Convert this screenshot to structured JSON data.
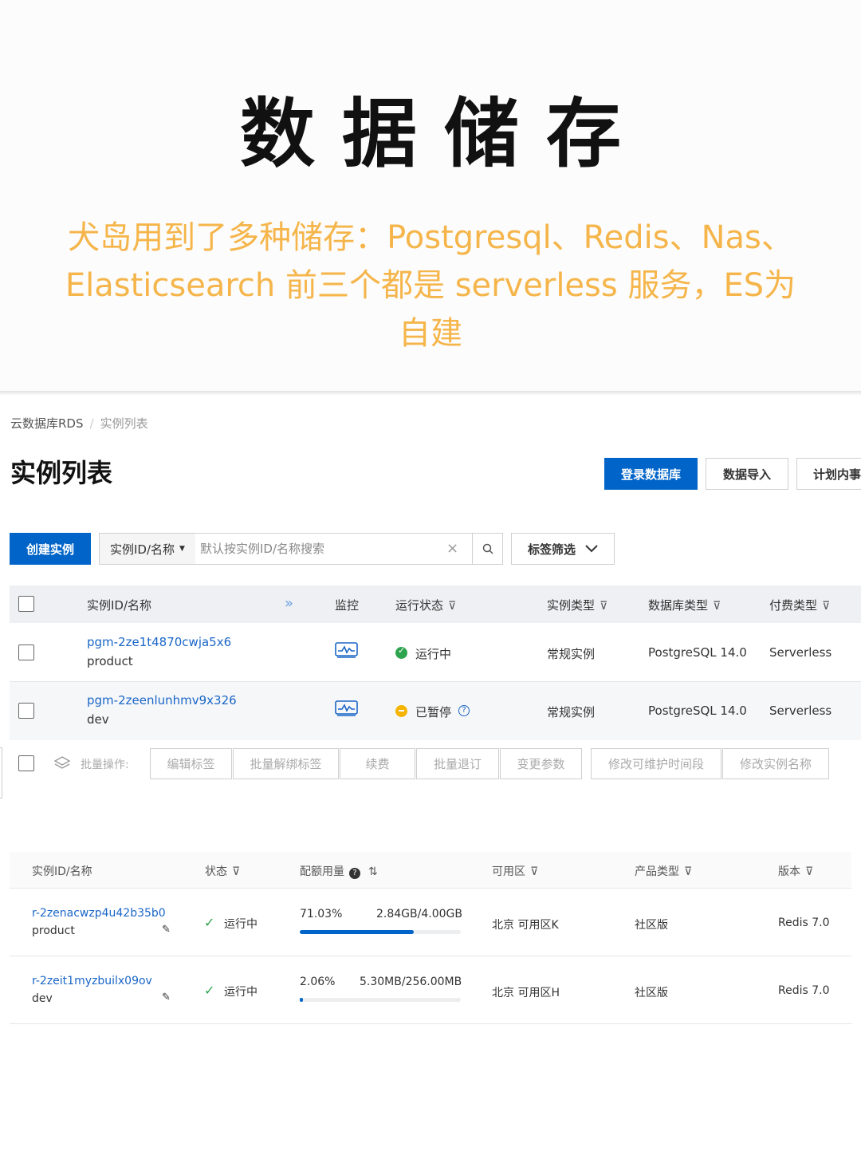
{
  "banner": {
    "title": "数据储存",
    "subtitle": "犬岛用到了多种储存：Postgresql、Redis、Nas、Elasticsearch 前三个都是 serverless 服务，ES为自建"
  },
  "breadcrumb": {
    "root": "云数据库RDS",
    "current": "实例列表"
  },
  "page_title": "实例列表",
  "header_buttons": {
    "login_db": "登录数据库",
    "data_import": "数据导入",
    "plan": "计划内事"
  },
  "toolbar": {
    "create": "创建实例",
    "search_select": "实例ID/名称",
    "search_placeholder": "默认按实例ID/名称搜索",
    "tag_filter": "标签筛选"
  },
  "rds_table": {
    "columns": [
      "实例ID/名称",
      "监控",
      "运行状态",
      "实例类型",
      "数据库类型",
      "付费类型"
    ],
    "rows": [
      {
        "id": "pgm-2ze1t4870cwja5x6",
        "name": "product",
        "status": "运行中",
        "type": "常规实例",
        "db": "PostgreSQL 14.0",
        "pay": "Serverless"
      },
      {
        "id": "pgm-2zeenlunhmv9x326",
        "name": "dev",
        "status": "已暂停",
        "type": "常规实例",
        "db": "PostgreSQL 14.0",
        "pay": "Serverless"
      }
    ],
    "batch_label": "批量操作:",
    "batch_buttons": [
      "编辑标签",
      "批量解绑标签",
      "续费",
      "批量退订",
      "变更参数",
      "修改可维护时间段",
      "修改实例名称"
    ]
  },
  "redis_table": {
    "columns": [
      "实例ID/名称",
      "状态",
      "配额用量",
      "可用区",
      "产品类型",
      "版本"
    ],
    "rows": [
      {
        "id": "r-2zenacwzp4u42b35b0",
        "name": "product",
        "status": "运行中",
        "usage_pct": "71.03%",
        "usage": "2.84GB/4.00GB",
        "usage_fraction": 0.7103,
        "zone": "北京 可用区K",
        "product": "社区版",
        "version": "Redis 7.0"
      },
      {
        "id": "r-2zeit1myzbuilx09ov",
        "name": "dev",
        "status": "运行中",
        "usage_pct": "2.06%",
        "usage": "5.30MB/256.00MB",
        "usage_fraction": 0.0206,
        "zone": "北京 可用区H",
        "product": "社区版",
        "version": "Redis 7.0"
      }
    ]
  },
  "colors": {
    "primary": "#0064c8",
    "link": "#1a66c7",
    "subtitle": "#f5b54a",
    "running": "#2fa44f",
    "paused": "#f5b400"
  }
}
